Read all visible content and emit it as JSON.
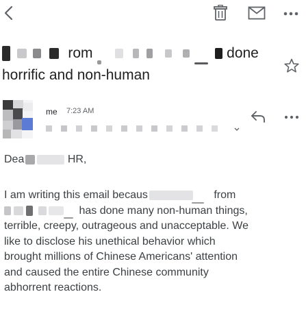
{
  "toolbar": {
    "back": "back-arrow",
    "delete": "trash",
    "mark_unread": "mail",
    "more": "more-horizontal"
  },
  "subject": {
    "line1_part1": "rom",
    "line1_part2": "done",
    "line2": "horrific and non-human"
  },
  "message": {
    "sender": "me",
    "time": "7:23 AM",
    "avatar_colors": [
      "#3a3a3a",
      "#5b7bd5",
      "#b7b7b7"
    ]
  },
  "body": {
    "greeting_start": "Dea",
    "greeting_end": "HR,",
    "lines": [
      "I am writing this email becaus",
      "from",
      "has done many non-human things,",
      "terrible, creepy, outrageous and unacceptable. We",
      "like to disclose his unethical behavior which",
      "brought millions of Chinese Americans' attention",
      "and caused the entire Chinese community",
      "abhorrent reactions."
    ]
  },
  "colors": {
    "icon": "#5f6368",
    "text": "#3c4043",
    "redaction_light": "#d7d7da",
    "redaction_dark": "#2b2b2b"
  }
}
